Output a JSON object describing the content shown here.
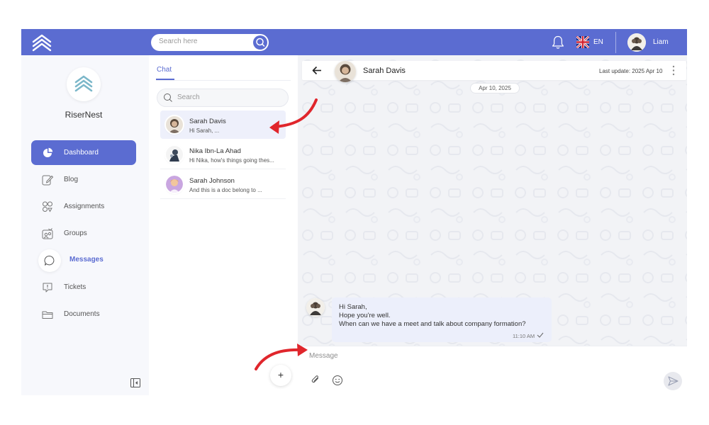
{
  "topbar": {
    "search_placeholder": "Search here",
    "language": "EN",
    "user_name": "Liam"
  },
  "sidebar": {
    "org_name": "RiserNest",
    "items": [
      {
        "label": "Dashboard",
        "icon": "pie-chart-icon",
        "state": "active"
      },
      {
        "label": "Blog",
        "icon": "edit-icon",
        "state": "normal"
      },
      {
        "label": "Assignments",
        "icon": "assignments-icon",
        "state": "normal"
      },
      {
        "label": "Groups",
        "icon": "groups-icon",
        "state": "normal"
      },
      {
        "label": "Messages",
        "icon": "chat-bubble-icon",
        "state": "current"
      },
      {
        "label": "Tickets",
        "icon": "ticket-icon",
        "state": "normal"
      },
      {
        "label": "Documents",
        "icon": "folder-icon",
        "state": "normal"
      }
    ]
  },
  "chatlist": {
    "tab": "Chat",
    "search_placeholder": "Search",
    "chats": [
      {
        "name": "Sarah Davis",
        "preview": "Hi Sarah, ...",
        "selected": true
      },
      {
        "name": "Nika Ibn-La Ahad",
        "preview": "Hi Nika, how's things going thes...",
        "selected": false
      },
      {
        "name": "Sarah Johnson",
        "preview": "And this is a doc belong to ...",
        "selected": false
      }
    ],
    "add_label": "+"
  },
  "conversation": {
    "contact_name": "Sarah Davis",
    "last_update": "Last update: 2025 Apr 10",
    "date_divider": "Apr 10, 2025",
    "message": {
      "lines": [
        "Hi Sarah,",
        "Hope you're well.",
        "When can we have a meet and talk about company formation?"
      ],
      "time": "11:10 AM",
      "status": "sent"
    },
    "composer_placeholder": "Message"
  },
  "colors": {
    "brand": "#5b6cd1",
    "annotation_arrow": "#e0262c",
    "selected_chat_bg": "#eef0fb",
    "bubble_bg": "#eceffb"
  }
}
